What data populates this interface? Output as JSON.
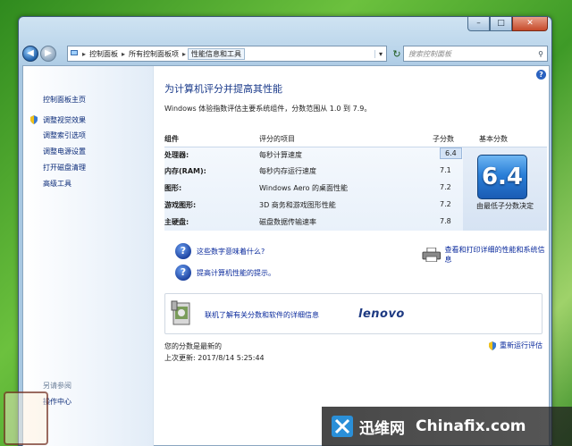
{
  "caption": {
    "minimize": "–",
    "maximize": "□",
    "close": "✕"
  },
  "nav": {
    "back_glyph": "◀",
    "forward_glyph": "▶",
    "breadcrumb": [
      "控制面板",
      "所有控制面板项",
      "性能信息和工具"
    ],
    "refresh_glyph": "↻",
    "search_placeholder": "搜索控制面板"
  },
  "sidebar": {
    "home": "控制面板主页",
    "items": [
      "调整视觉效果",
      "调整索引选项",
      "调整电源设置",
      "打开磁盘清理",
      "高级工具"
    ],
    "see_also_title": "另请参阅",
    "see_also_items": [
      "操作中心"
    ]
  },
  "main": {
    "title": "为计算机评分并提高其性能",
    "subtitle": "Windows 体验指数评估主要系统组件，分数范围从 1.0 到 7.9。",
    "headers": {
      "component": "组件",
      "rated": "评分的项目",
      "subscore": "子分数",
      "basescore": "基本分数"
    },
    "rows": [
      {
        "component": "处理器:",
        "item": "每秒计算速度",
        "score": "6.4"
      },
      {
        "component": "内存(RAM):",
        "item": "每秒内存运行速度",
        "score": "7.1"
      },
      {
        "component": "图形:",
        "item": "Windows Aero 的桌面性能",
        "score": "7.2"
      },
      {
        "component": "游戏图形:",
        "item": "3D 商务和游戏图形性能",
        "score": "7.2"
      },
      {
        "component": "主硬盘:",
        "item": "磁盘数据传输速率",
        "score": "7.8"
      }
    ],
    "base_score": "6.4",
    "base_caption": "由最低子分数决定",
    "link_meaning": "这些数字意味着什么?",
    "link_tips": "提高计算机性能的提示。",
    "link_print": "查看和打印详细的性能和系统信息",
    "link_online": "联机了解有关分数和软件的详细信息",
    "lenovo": "lenovo",
    "status_current": "您的分数是最新的",
    "status_updated": "上次更新: 2017/8/14 5:25:44",
    "rerun": "重新运行评估"
  },
  "watermark": {
    "cn": "迅维网",
    "en": "Chinafix.com"
  },
  "colors": {
    "link": "#0a2a9c",
    "title": "#1a3a8a",
    "score_tile": "#2a7fd8"
  }
}
